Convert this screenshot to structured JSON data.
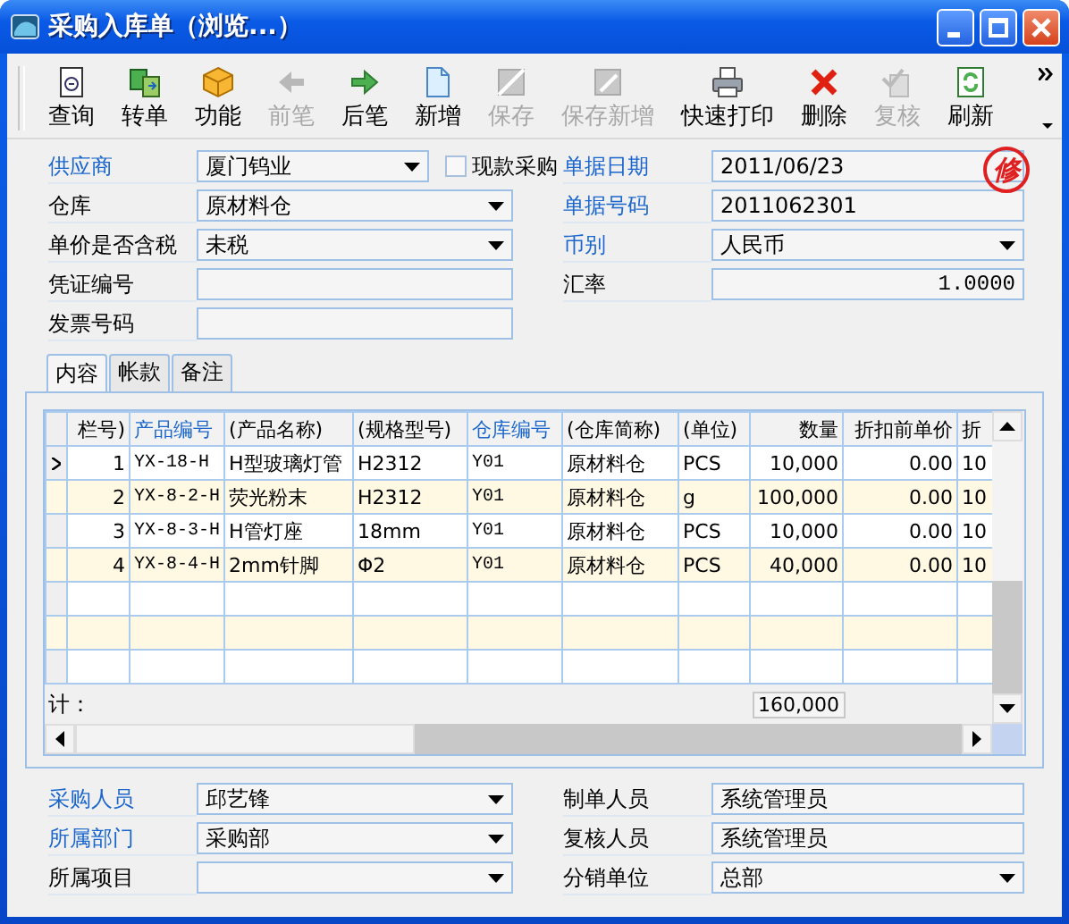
{
  "window": {
    "title": "采购入库单（浏览...）"
  },
  "toolbar": [
    {
      "label": "查询",
      "disabled": false
    },
    {
      "label": "转单",
      "disabled": false
    },
    {
      "label": "功能",
      "disabled": false
    },
    {
      "label": "前笔",
      "disabled": true
    },
    {
      "label": "后笔",
      "disabled": false
    },
    {
      "label": "新增",
      "disabled": false
    },
    {
      "label": "保存",
      "disabled": true
    },
    {
      "label": "保存新增",
      "disabled": true
    },
    {
      "label": "快速打印",
      "disabled": false
    },
    {
      "label": "删除",
      "disabled": false
    },
    {
      "label": "复核",
      "disabled": true
    },
    {
      "label": "刷新",
      "disabled": false
    }
  ],
  "form": {
    "left": [
      {
        "label": "供应商",
        "required": true,
        "kind": "dropdown",
        "value": "厦门钨业",
        "checkbox": {
          "label": "现款采购",
          "checked": false
        }
      },
      {
        "label": "仓库",
        "required": false,
        "kind": "dropdown",
        "value": "原材料仓"
      },
      {
        "label": "单价是否含税",
        "required": false,
        "kind": "dropdown",
        "value": "未税"
      },
      {
        "label": "凭证编号",
        "required": false,
        "kind": "text"
      },
      {
        "label": "发票号码",
        "required": false,
        "kind": "text"
      }
    ],
    "right": [
      {
        "label": "单据日期",
        "required": true,
        "kind": "text",
        "value": "2011/06/23"
      },
      {
        "label": "单据号码",
        "required": true,
        "kind": "text",
        "value": "2011062301"
      },
      {
        "label": "币别",
        "required": true,
        "kind": "dropdown",
        "value": "人民币"
      },
      {
        "label": "汇率",
        "required": false,
        "kind": "number",
        "value": "1.0000"
      }
    ],
    "stamp": "修"
  },
  "tabs": [
    {
      "label": "内容",
      "selected": true
    },
    {
      "label": "帐款",
      "selected": false
    },
    {
      "label": "备注",
      "selected": false
    }
  ],
  "table": {
    "columns": [
      {
        "label": "栏号)",
        "highlighted": false,
        "kind": "number"
      },
      {
        "label": "产品编号",
        "highlighted": true,
        "kind": "code"
      },
      {
        "label": "(产品名称)",
        "highlighted": false,
        "kind": "text"
      },
      {
        "label": "(规格型号)",
        "highlighted": false,
        "kind": "text"
      },
      {
        "label": "仓库编号",
        "highlighted": true,
        "kind": "code"
      },
      {
        "label": "(仓库简称)",
        "highlighted": false,
        "kind": "text"
      },
      {
        "label": "(单位)",
        "highlighted": false,
        "kind": "text"
      },
      {
        "label": "数量",
        "highlighted": false,
        "kind": "number"
      },
      {
        "label": "折扣前单价",
        "highlighted": false,
        "kind": "number"
      },
      {
        "label": "折",
        "highlighted": false,
        "kind": "text"
      }
    ],
    "rows": [
      {
        "current": true,
        "cells": [
          "1",
          "YX-18-H",
          "H型玻璃灯管",
          "H2312",
          "Y01",
          "原材料仓",
          "PCS",
          "10,000",
          "0.00",
          "10"
        ]
      },
      {
        "current": false,
        "cells": [
          "2",
          "YX-8-2-H",
          "荧光粉末",
          "H2312",
          "Y01",
          "原材料仓",
          "g",
          "100,000",
          "0.00",
          "10"
        ]
      },
      {
        "current": false,
        "cells": [
          "3",
          "YX-8-3-H",
          "H管灯座",
          "18mm",
          "Y01",
          "原材料仓",
          "PCS",
          "10,000",
          "0.00",
          "10"
        ]
      },
      {
        "current": false,
        "cells": [
          "4",
          "YX-8-4-H",
          "2mm针脚",
          "Φ2",
          "Y01",
          "原材料仓",
          "PCS",
          "40,000",
          "0.00",
          "10"
        ]
      }
    ],
    "footer": {
      "label": "计：",
      "total": "160,000"
    }
  },
  "bottom_form": {
    "left": [
      {
        "label": "采购人员",
        "required": true,
        "kind": "dropdown",
        "value": "邱艺锋"
      },
      {
        "label": "所属部门",
        "required": true,
        "kind": "dropdown",
        "value": "采购部"
      },
      {
        "label": "所属项目",
        "required": false,
        "kind": "dropdown"
      }
    ],
    "right": [
      {
        "label": "制单人员",
        "required": false,
        "kind": "text",
        "value": "系统管理员"
      },
      {
        "label": "复核人员",
        "required": false,
        "kind": "text",
        "value": "系统管理员"
      },
      {
        "label": "分销单位",
        "required": false,
        "kind": "dropdown",
        "value": "总部"
      }
    ]
  }
}
